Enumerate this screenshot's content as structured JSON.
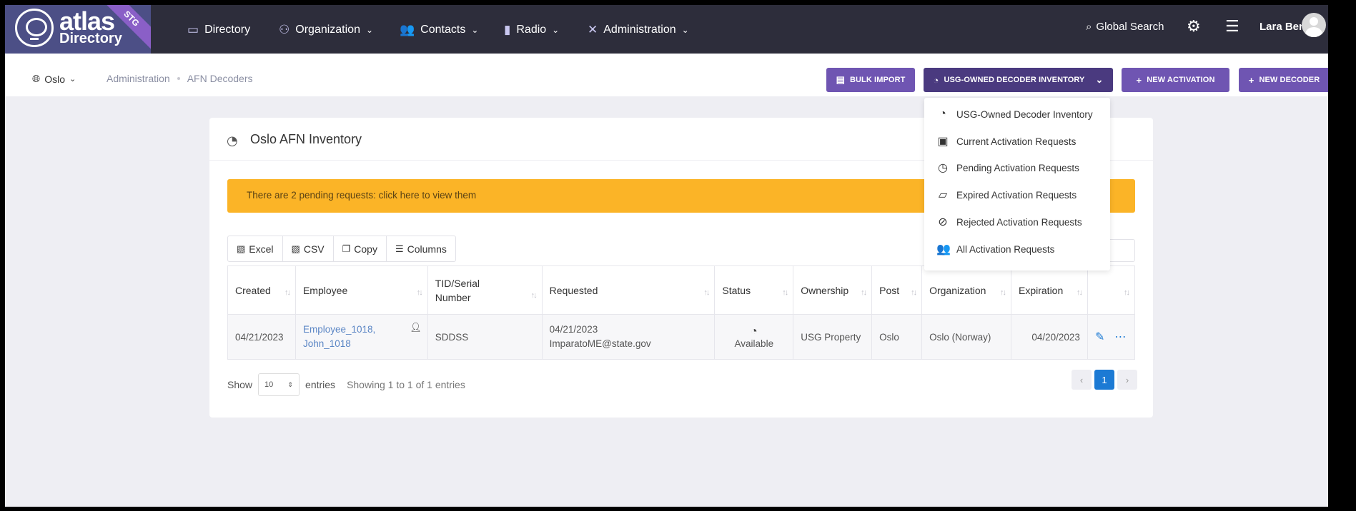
{
  "app": {
    "logo_title": "atlas",
    "logo_sub": "Directory",
    "env_badge": "STG"
  },
  "topnav": {
    "items": [
      {
        "label": "Directory",
        "icon": "directory-icon"
      },
      {
        "label": "Organization",
        "icon": "org-icon"
      },
      {
        "label": "Contacts",
        "icon": "contacts-icon"
      },
      {
        "label": "Radio",
        "icon": "radio-icon"
      },
      {
        "label": "Administration",
        "icon": "tools-icon"
      }
    ],
    "search_label": "Global Search",
    "user_name": "Lara Benitez"
  },
  "subbar": {
    "location": "Oslo",
    "breadcrumb": [
      "Administration",
      "AFN Decoders"
    ],
    "buttons": {
      "bulk_import": "BULK IMPORT",
      "inventory": "USG-OWNED DECODER INVENTORY",
      "new_activation": "NEW ACTIVATION",
      "new_decoder": "NEW DECODER"
    }
  },
  "dropdown": {
    "items": [
      {
        "label": "USG-Owned Decoder Inventory",
        "icon": "satellite-dish-icon"
      },
      {
        "label": "Current Activation Requests",
        "icon": "file-check-icon"
      },
      {
        "label": "Pending Activation Requests",
        "icon": "clock-icon"
      },
      {
        "label": "Expired Activation Requests",
        "icon": "folder-icon"
      },
      {
        "label": "Rejected Activation Requests",
        "icon": "ban-icon"
      },
      {
        "label": "All Activation Requests",
        "icon": "users-icon"
      }
    ]
  },
  "card": {
    "title": "Oslo AFN Inventory",
    "alert": "There are 2 pending requests: click here to view them",
    "toolbar": [
      "Excel",
      "CSV",
      "Copy",
      "Columns"
    ],
    "columns": [
      "Created",
      "Employee",
      "TID/Serial Number",
      "Requested",
      "Status",
      "Ownership",
      "Post",
      "Organization",
      "Expiration"
    ],
    "rows": [
      {
        "created": "04/21/2023",
        "employee": "Employee_1018, John_1018",
        "tid": "SDDSS",
        "requested_date": "04/21/2023",
        "requested_by": "ImparatoME@state.gov",
        "status": "Available",
        "ownership": "USG Property",
        "post": "Oslo",
        "organization": "Oslo (Norway)",
        "expiration": "04/20/2023"
      }
    ],
    "footer": {
      "show": "Show",
      "page_length": "10",
      "entries": "entries",
      "info": "Showing 1 to 1 of 1 entries",
      "current_page": "1"
    }
  },
  "colors": {
    "nav_bg": "#2d2d3b",
    "brand_purple": "#6f55b2",
    "alert": "#fbb427",
    "link_blue": "#1c7ad4"
  }
}
